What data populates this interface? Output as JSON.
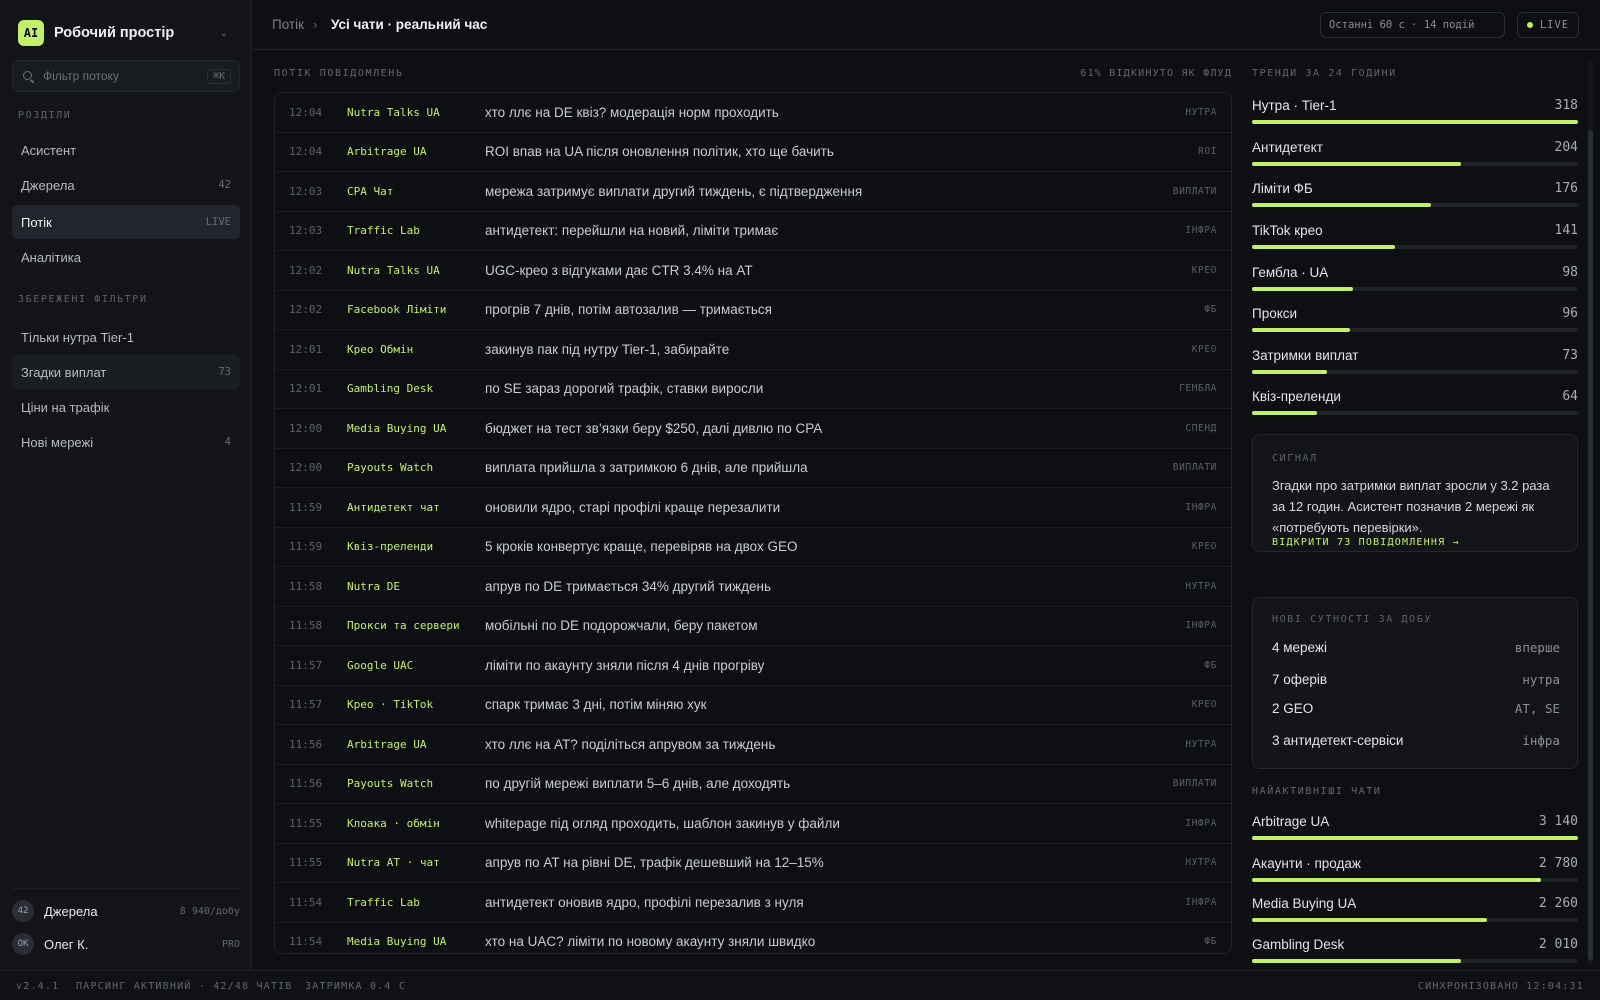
{
  "workspace": {
    "logo": "AI",
    "name": "Робочий простір"
  },
  "search": {
    "placeholder": "Фільтр потоку",
    "shortcut": "⌘K"
  },
  "sidebar": {
    "sections_title": "РОЗДІЛИ",
    "items": [
      {
        "label": "Асистент",
        "count": ""
      },
      {
        "label": "Джерела",
        "count": "42"
      },
      {
        "label": "Потік",
        "count": "LIVE"
      },
      {
        "label": "Аналітика",
        "count": ""
      }
    ],
    "saved_title": "ЗБЕРЕЖЕНІ ФІЛЬТРИ",
    "saved": [
      {
        "label": "Тільки нутра Tier-1",
        "count": ""
      },
      {
        "label": "Згадки виплат",
        "count": "73"
      },
      {
        "label": "Ціни на трафік",
        "count": ""
      },
      {
        "label": "Нові мережі",
        "count": "4"
      }
    ],
    "footer": {
      "sources_badge": "42",
      "sources_label": "Джерела",
      "sources_meta": "8 940/добу",
      "user_avatar": "ОК",
      "user_name": "Олег К.",
      "user_plan": "PRO"
    }
  },
  "header": {
    "breadcrumb_root": "Потік",
    "breadcrumb_sep": "›",
    "breadcrumb_current": "Усі чати · реальний час",
    "range": "Останні 60 с · 14 подій",
    "live": "LIVE"
  },
  "feed": {
    "title": "ПОТІК ПОВІДОМЛЕНЬ",
    "note": "61% ВІДКИНУТО ЯК ФЛУД",
    "rows": [
      {
        "time": "12:04",
        "source": "Nutra Talks UA",
        "text": "хто ллє на DE квіз? модерація норм проходить",
        "tag": "НУТРА"
      },
      {
        "time": "12:04",
        "source": "Arbitrage UA",
        "text": "ROI впав на UA після оновлення політик, хто ще бачить",
        "tag": "ROI"
      },
      {
        "time": "12:03",
        "source": "CPA Чат",
        "text": "мережа затримує виплати другий тиждень, є підтвердження",
        "tag": "ВИПЛАТИ"
      },
      {
        "time": "12:03",
        "source": "Traffic Lab",
        "text": "антидетект: перейшли на новий, ліміти тримає",
        "tag": "ІНФРА"
      },
      {
        "time": "12:02",
        "source": "Nutra Talks UA",
        "text": "UGC-крео з відгуками дає CTR 3.4% на AT",
        "tag": "КРЕО"
      },
      {
        "time": "12:02",
        "source": "Facebook Ліміти",
        "text": "прогрів 7 днів, потім автозалив — тримається",
        "tag": "ФБ"
      },
      {
        "time": "12:01",
        "source": "Крео Обмін",
        "text": "закинув пак під нутру Tier-1, забирайте",
        "tag": "КРЕО"
      },
      {
        "time": "12:01",
        "source": "Gambling Desk",
        "text": "по SE зараз дорогий трафік, ставки виросли",
        "tag": "ГЕМБЛА"
      },
      {
        "time": "12:00",
        "source": "Media Buying UA",
        "text": "бюджет на тест зв’язки беру $250, далі дивлю по CPA",
        "tag": "СПЕНД"
      },
      {
        "time": "12:00",
        "source": "Payouts Watch",
        "text": "виплата прийшла з затримкою 6 днів, але прийшла",
        "tag": "ВИПЛАТИ"
      },
      {
        "time": "11:59",
        "source": "Антидетект чат",
        "text": "оновили ядро, старі профілі краще перезалити",
        "tag": "ІНФРА"
      },
      {
        "time": "11:59",
        "source": "Квіз-преленди",
        "text": "5 кроків конвертує краще, перевіряв на двох GEO",
        "tag": "КРЕО"
      },
      {
        "time": "11:58",
        "source": "Nutra DE",
        "text": "апрув по DE тримається 34% другий тиждень",
        "tag": "НУТРА"
      },
      {
        "time": "11:58",
        "source": "Прокси та сервери",
        "text": "мобільні по DE подорожчали, беру пакетом",
        "tag": "ІНФРА"
      },
      {
        "time": "11:57",
        "source": "Google UAC",
        "text": "ліміти по акаунту зняли після 4 днів прогріву",
        "tag": "ФБ"
      },
      {
        "time": "11:57",
        "source": "Крео · TikTok",
        "text": "спарк тримає 3 дні, потім міняю хук",
        "tag": "КРЕО"
      },
      {
        "time": "11:56",
        "source": "Arbitrage UA",
        "text": "хто ллє на AT? поділіться апрувом за тиждень",
        "tag": "НУТРА"
      },
      {
        "time": "11:56",
        "source": "Payouts Watch",
        "text": "по другій мережі виплати 5–6 днів, але доходять",
        "tag": "ВИПЛАТИ"
      },
      {
        "time": "11:55",
        "source": "Клоака · обмін",
        "text": "whitepage під огляд проходить, шаблон закинув у файли",
        "tag": "ІНФРА"
      },
      {
        "time": "11:55",
        "source": "Nutra AT · чат",
        "text": "апрув по AT на рівні DE, трафік дешевший на 12–15%",
        "tag": "НУТРА"
      },
      {
        "time": "11:54",
        "source": "Traffic Lab",
        "text": "антидетект оновив ядро, профілі перезалив з нуля",
        "tag": "ІНФРА"
      },
      {
        "time": "11:54",
        "source": "Media Buying UA",
        "text": "хто на UAC? ліміти по новому акаунту зняли швидко",
        "tag": "ФБ"
      }
    ]
  },
  "trends": {
    "title": "ТРЕНДИ ЗА 24 ГОДИНИ",
    "items": [
      {
        "name": "Нутра · Tier-1",
        "value": "318",
        "fraction": 1.0
      },
      {
        "name": "Антидетект",
        "value": "204",
        "fraction": 0.64
      },
      {
        "name": "Ліміти ФБ",
        "value": "176",
        "fraction": 0.55
      },
      {
        "name": "TikTok крео",
        "value": "141",
        "fraction": 0.44
      },
      {
        "name": "Гембла · UA",
        "value": "98",
        "fraction": 0.31
      },
      {
        "name": "Прокси",
        "value": "96",
        "fraction": 0.3
      },
      {
        "name": "Затримки виплат",
        "value": "73",
        "fraction": 0.23
      },
      {
        "name": "Квіз-преленди",
        "value": "64",
        "fraction": 0.2
      }
    ]
  },
  "signal": {
    "title": "СИГНАЛ",
    "text": "Згадки про затримки виплат зросли у 3.2 раза за 12 годин. Асистент позначив 2 мережі як «потребують перевірки».",
    "link": "ВІДКРИТИ 73 ПОВІДОМЛЕННЯ →"
  },
  "entities": {
    "title": "НОВІ СУТНОСТІ ЗА ДОБУ",
    "items": [
      {
        "label": "4 мережі",
        "meta": "вперше"
      },
      {
        "label": "7 оферів",
        "meta": "нутра"
      },
      {
        "label": "2 GEO",
        "meta": "AT, SE"
      },
      {
        "label": "3 антидетект-сервіси",
        "meta": "інфра"
      }
    ]
  },
  "top_chats": {
    "title": "НАЙАКТИВНІШІ ЧАТИ",
    "items": [
      {
        "name": "Arbitrage UA",
        "value": "3 140",
        "fraction": 1.0
      },
      {
        "name": "Акаунти · продаж",
        "value": "2 780",
        "fraction": 0.885
      },
      {
        "name": "Media Buying UA",
        "value": "2 260",
        "fraction": 0.72
      },
      {
        "name": "Gambling Desk",
        "value": "2 010",
        "fraction": 0.64
      }
    ]
  },
  "statusbar": {
    "version": "v2.4.1",
    "parsing": "ПАРСИНГ АКТИВНИЙ · 42/48 ЧАТІВ",
    "delay": "ЗАТРИМКА 0.4 С",
    "sync": "СИНХРОНІЗОВАНО 12:04:31"
  },
  "colors": {
    "accent": "#c3f06a",
    "background": "#0d0f12",
    "sidebar": "#121418"
  }
}
